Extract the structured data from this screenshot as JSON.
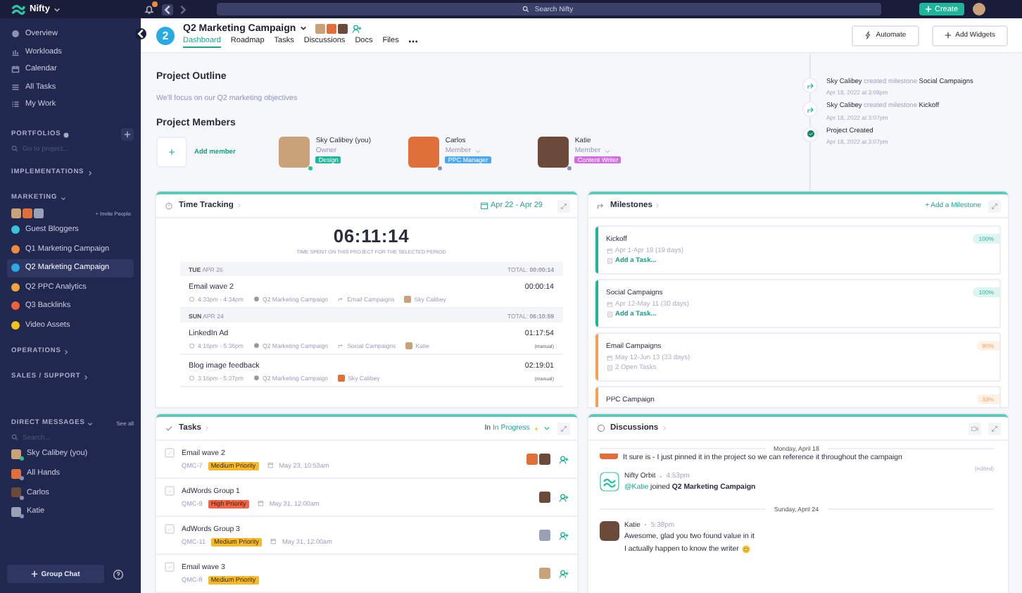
{
  "topbar": {
    "workspace": "Nifty",
    "search_placeholder": "Search Nifty",
    "create_button": "Create",
    "notification_badge": true
  },
  "sidebar": {
    "nav": [
      {
        "label": "Overview",
        "selected": false
      },
      {
        "label": "Workloads",
        "selected": false
      },
      {
        "label": "Calendar",
        "selected": false
      },
      {
        "label": "All Tasks",
        "selected": false
      },
      {
        "label": "My Work",
        "selected": false
      }
    ],
    "portfolios": {
      "title": "PORTFOLIOS",
      "search_placeholder": "Go to project..."
    },
    "groups": [
      {
        "title": "IMPLEMENTATIONS",
        "expanded": false
      },
      {
        "title": "MARKETING",
        "expanded": true,
        "invite": "+ Invite People",
        "projects": [
          {
            "name": "Guest Bloggers",
            "color": "#3cc3dc",
            "selected": false
          },
          {
            "name": "Q1 Marketing Campaign",
            "color": "#f28a3c",
            "selected": false
          },
          {
            "name": "Q2 Marketing Campaign",
            "color": "#2aa9e2",
            "selected": true
          },
          {
            "name": "Q2 PPC Analytics",
            "color": "#f2a33a",
            "selected": false
          },
          {
            "name": "Q3 Backlinks",
            "color": "#f0623a",
            "selected": false
          },
          {
            "name": "Video Assets",
            "color": "#f3c21b",
            "selected": false
          }
        ]
      },
      {
        "title": "OPERATIONS",
        "expanded": false
      },
      {
        "title": "SALES / SUPPORT",
        "expanded": false
      }
    ],
    "direct_messages": {
      "title": "DIRECT MESSAGES",
      "see_all": "See all",
      "search_placeholder": "Search...",
      "people": [
        {
          "name": "Sky Calibey (you)",
          "online": true
        },
        {
          "name": "All Hands",
          "online": false
        },
        {
          "name": "Carlos",
          "online": false
        },
        {
          "name": "Katie",
          "online": false
        }
      ]
    },
    "group_chat_button": "Group Chat"
  },
  "project": {
    "number": "2",
    "title": "Q2 Marketing Campaign",
    "tabs": [
      {
        "label": "Dashboard",
        "selected": true
      },
      {
        "label": "Roadmap",
        "selected": false
      },
      {
        "label": "Tasks",
        "selected": false
      },
      {
        "label": "Discussions",
        "selected": false
      },
      {
        "label": "Docs",
        "selected": false
      },
      {
        "label": "Files",
        "selected": false
      }
    ],
    "buttons": [
      {
        "label": "Automate",
        "kind": "automate"
      },
      {
        "label": "Add Widgets",
        "kind": "add"
      }
    ]
  },
  "outline": {
    "title": "Project Outline",
    "description": "We'll focus on our Q2 marketing objectives"
  },
  "members": {
    "title": "Project Members",
    "add_label": "Add member",
    "people": [
      {
        "name": "Sky Calibey (you)",
        "role": "Owner",
        "role_menu": false,
        "tag": "Design",
        "color": "#1fb59b",
        "online": true
      },
      {
        "name": "Carlos",
        "role": "Member",
        "role_menu": true,
        "tag": "PPC Manager",
        "color": "#4aa8f0",
        "online": false
      },
      {
        "name": "Katie",
        "role": "Member",
        "role_menu": true,
        "tag": "Content Writer",
        "color": "#d46be2",
        "online": false
      }
    ]
  },
  "activity": [
    {
      "kind": "milestone",
      "actor": "Sky Calibey",
      "action": "created milestone",
      "target": "Social Campaigns",
      "time": "Apr 18, 2022 at 3:08pm"
    },
    {
      "kind": "milestone",
      "actor": "Sky Calibey",
      "action": "created milestone",
      "target": "Kickoff",
      "time": "Apr 18, 2022 at 3:07pm"
    },
    {
      "kind": "created",
      "actor": "Project Created",
      "time": "Apr 18, 2022 at 3:07pm"
    }
  ],
  "time_tracking": {
    "title": "Time Tracking",
    "range": "Apr 22 - Apr 29",
    "total": "06:11:14",
    "caption": "TIME SPENT ON THIS PROJECT FOR THE SELECTED PERIOD",
    "days": [
      {
        "day": "TUE",
        "date": "APR 26",
        "total_label": "TOTAL:",
        "total": "00:00:14",
        "entries": [
          {
            "title": "Email wave 2",
            "duration": "00:00:14",
            "time": "4:33pm - 4:34pm",
            "project": "Q2 Marketing Campaign",
            "milestone": "Email Campaigns",
            "person": "Sky Calibey"
          }
        ]
      },
      {
        "day": "SUN",
        "date": "APR 24",
        "total_label": "TOTAL:",
        "total": "06:10:59",
        "entries": [
          {
            "title": "LinkedIn Ad",
            "duration": "01:17:54",
            "note": "(manual)",
            "time": "4:16pm - 5:36pm",
            "project": "Q2 Marketing Campaign",
            "milestone": "Social Campaigns",
            "person": "Katie"
          },
          {
            "title": "Blog image feedback",
            "duration": "02:19:01",
            "note": "(manual)",
            "time": "3:16pm - 5:37pm",
            "project": "Q2 Marketing Campaign",
            "person": "Sky Calibey"
          }
        ]
      }
    ]
  },
  "milestones": {
    "title": "Milestones",
    "add_label": "+ Add a Milestone",
    "items": [
      {
        "name": "Kickoff",
        "dates": "Apr 1-Apr 19 (19 days)",
        "sub": "Add a Task...",
        "kind": "link",
        "percent": "100%",
        "color": "#1fb59b"
      },
      {
        "name": "Social Campaigns",
        "dates": "Apr 12-May 11 (30 days)",
        "sub": "Add a Task...",
        "kind": "link",
        "percent": "100%",
        "color": "#1fb59b"
      },
      {
        "name": "Email Campaigns",
        "dates": "May 12-Jun 13 (33 days)",
        "sub": "2 Open Tasks",
        "kind": "count",
        "percent": "90%",
        "color": "#f5a05a"
      },
      {
        "name": "PPC Campaign",
        "percent": "33%",
        "color": "#f5a05a"
      }
    ]
  },
  "tasks": {
    "title": "Tasks",
    "filter_prefix": "In",
    "filter": "In Progress",
    "items": [
      {
        "title": "Email wave 2",
        "checked": false,
        "code": "QMC-7",
        "priority": "Medium Priority",
        "color": "#f6b92b",
        "due": "May 23, 10:53am"
      },
      {
        "title": "AdWords Group 1",
        "checked": false,
        "code": "QMC-9",
        "priority": "High Priority",
        "color": "#f0644a",
        "due": "May 31, 12:00am"
      },
      {
        "title": "AdWords Group 3",
        "checked": false,
        "code": "QMC-11",
        "priority": "Medium Priority",
        "color": "#f6b92b",
        "due": "May 31, 12:00am"
      },
      {
        "title": "Email wave 3",
        "checked": false,
        "code": "QMC-8",
        "priority": "Medium Priority",
        "color": "#f6b92b"
      }
    ]
  },
  "discussions": {
    "title": "Discussions",
    "items": [
      {
        "kind": "separator",
        "text": "Monday, April 18"
      },
      {
        "kind": "continued",
        "lines": [
          "It sure is - I just pinned it in the project so we can reference it throughout the campaign"
        ],
        "edited": "(edited)"
      },
      {
        "kind": "bot",
        "author": "Nifty Orbit",
        "time": "4:53pm",
        "mention": "@Katie",
        "text": "joined **Q2 Marketing Campaign**"
      },
      {
        "kind": "separator",
        "text": "Sunday, April 24"
      },
      {
        "kind": "message",
        "author": "Katie",
        "time": "5:38pm",
        "lines": [
          "Awesome, glad you two found value in it",
          "I actually happen to know the writer"
        ],
        "emoji": true
      }
    ]
  }
}
